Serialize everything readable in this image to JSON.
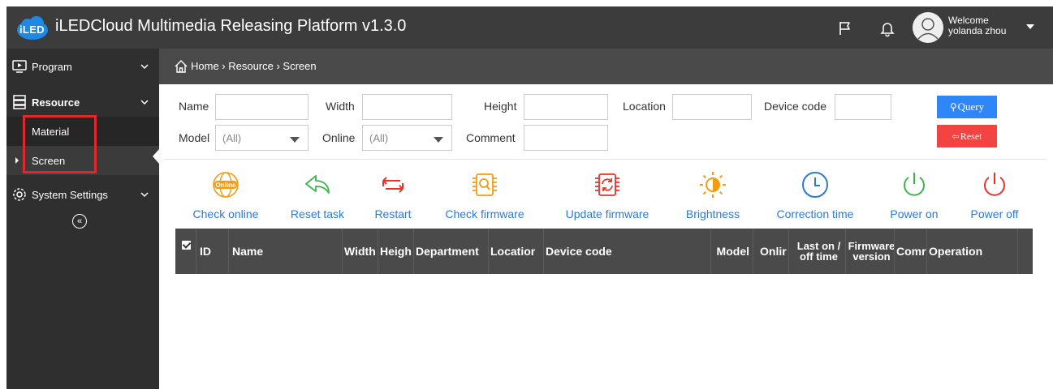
{
  "app": {
    "title": "iLEDCloud Multimedia Releasing Platform v1.3.0",
    "logo_text": "iLED",
    "welcome": "Welcome",
    "username": "yolanda zhou"
  },
  "colors": {
    "header_bg": "#3c3c3c",
    "sidebar_bg": "#2f2f2f",
    "accent_blue": "#2f86f6",
    "accent_red": "#f24443",
    "orange": "#f5a623",
    "green": "#3bb54a"
  },
  "sidebar": {
    "program": "Program",
    "resource": "Resource",
    "material": "Material",
    "screen": "Screen",
    "system_settings": "System Settings"
  },
  "breadcrumb": {
    "text": "Home › Resource › Screen"
  },
  "filters": {
    "name": "Name",
    "width": "Width",
    "height": "Height",
    "location": "Location",
    "device_code": "Device code",
    "model": "Model",
    "model_value": "(All)",
    "online": "Online",
    "online_value": "(All)",
    "comment": "Comment",
    "query": "Query",
    "reset": "Reset"
  },
  "toolbar": {
    "online_badge": "Online",
    "check_online": "Check online",
    "reset_task": "Reset task",
    "restart": "Restart",
    "check_firmware": "Check firmware",
    "update_firmware": "Update firmware",
    "brightness": "Brightness",
    "correction_time": "Correction time",
    "power_on": "Power on",
    "power_off": "Power off"
  },
  "table": {
    "columns": {
      "id": "ID",
      "name": "Name",
      "width": "Width",
      "height": "Heigh",
      "department": "Department",
      "location": "Locatior",
      "device_code": "Device code",
      "model": "Model",
      "online": "Onlir",
      "last_on_off_1": "Last on /",
      "last_on_off_2": "off time",
      "firmware_1": "Firmware",
      "firmware_2": "version",
      "comment": "Comr",
      "operation": "Operation"
    }
  }
}
